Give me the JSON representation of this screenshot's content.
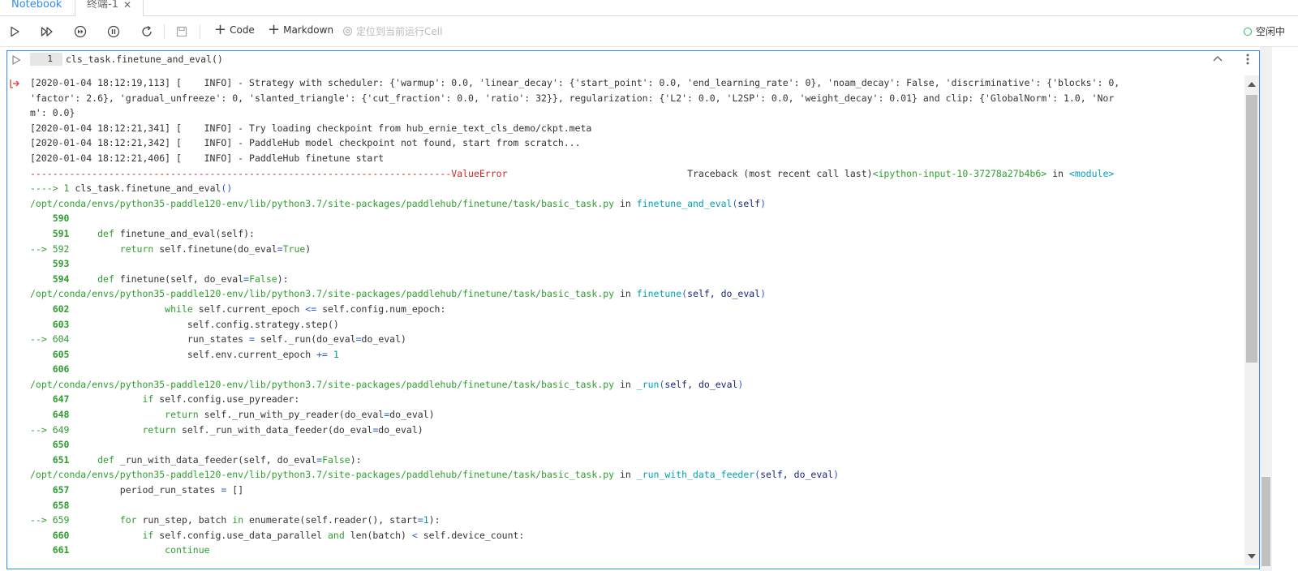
{
  "tabs": [
    {
      "label": "Notebook"
    },
    {
      "label": "终端-1"
    }
  ],
  "toolbar": {
    "code_label": "Code",
    "markdown_label": "Markdown",
    "locate_label": "定位到当前运行Cell",
    "status_label": "空闲中",
    "status_color": "#19be6b"
  },
  "cell": {
    "line_number": "1",
    "code": "cls_task.finetune_and_eval()"
  },
  "output": {
    "lines": [
      [
        {
          "t": "[2020-01-04 18:12:19,113] [    INFO] - Strategy with scheduler: {'warmup': 0.0, 'linear_decay': {'start_point': 0.0, 'end_learning_rate': 0}, 'noam_decay': False, 'discriminative': {'blocks': 0,",
          "c": ""
        }
      ],
      [
        {
          "t": "'factor': 2.6}, 'gradual_unfreeze': 0, 'slanted_triangle': {'cut_fraction': 0.0, 'ratio': 32}}, regularization: {'L2': 0.0, 'L2SP': 0.0, 'weight_decay': 0.01} and clip: {'GlobalNorm': 1.0, 'Nor",
          "c": ""
        }
      ],
      [
        {
          "t": "m': 0.0}",
          "c": ""
        }
      ],
      [
        {
          "t": "[2020-01-04 18:12:21,341] [    INFO] - Try loading checkpoint from hub_ernie_text_cls_demo/ckpt.meta",
          "c": ""
        }
      ],
      [
        {
          "t": "[2020-01-04 18:12:21,342] [    INFO] - PaddleHub model checkpoint not found, start from scratch...",
          "c": ""
        }
      ],
      [
        {
          "t": "[2020-01-04 18:12:21,406] [    INFO] - PaddleHub finetune start",
          "c": ""
        }
      ],
      [
        {
          "t": "---------------------------------------------------------------------------ValueError",
          "c": "red"
        },
        {
          "t": "                                Traceback (most recent call last)",
          "c": ""
        },
        {
          "t": "<ipython-input-10-37278a27b4b6>",
          "c": "green"
        },
        {
          "t": " in ",
          "c": ""
        },
        {
          "t": "<module>",
          "c": "teal"
        }
      ],
      [
        {
          "t": "----> 1 ",
          "c": "green"
        },
        {
          "t": "cls_task",
          "c": ""
        },
        {
          "t": ".",
          "c": ""
        },
        {
          "t": "finetune_and_eval",
          "c": ""
        },
        {
          "t": "()",
          "c": "blue"
        }
      ],
      [
        {
          "t": "/opt/conda/envs/python35-paddle120-env/lib/python3.7/site-packages/paddlehub/finetune/task/basic_task.py",
          "c": "green"
        },
        {
          "t": " in ",
          "c": ""
        },
        {
          "t": "finetune_and_eval",
          "c": "teal"
        },
        {
          "t": "(",
          "c": "blue"
        },
        {
          "t": "self",
          "c": "navy"
        },
        {
          "t": ")",
          "c": "blue"
        }
      ],
      [
        {
          "t": "    590",
          "c": "lno"
        }
      ],
      [
        {
          "t": "    591     ",
          "c": "lno"
        },
        {
          "t": "def",
          "c": "kw"
        },
        {
          "t": " finetune_and_eval(self):",
          "c": ""
        }
      ],
      [
        {
          "t": "--> 592         ",
          "c": "green"
        },
        {
          "t": "return",
          "c": "kw"
        },
        {
          "t": " self.finetune(do_eval",
          "c": ""
        },
        {
          "t": "=",
          "c": "blue"
        },
        {
          "t": "True",
          "c": "kw"
        },
        {
          "t": ")",
          "c": ""
        }
      ],
      [
        {
          "t": "    593",
          "c": "lno"
        }
      ],
      [
        {
          "t": "    594     ",
          "c": "lno"
        },
        {
          "t": "def",
          "c": "kw"
        },
        {
          "t": " finetune(self, do_eval",
          "c": ""
        },
        {
          "t": "=",
          "c": "blue"
        },
        {
          "t": "False",
          "c": "kw"
        },
        {
          "t": "):",
          "c": ""
        }
      ],
      [
        {
          "t": "/opt/conda/envs/python35-paddle120-env/lib/python3.7/site-packages/paddlehub/finetune/task/basic_task.py",
          "c": "green"
        },
        {
          "t": " in ",
          "c": ""
        },
        {
          "t": "finetune",
          "c": "teal"
        },
        {
          "t": "(",
          "c": "blue"
        },
        {
          "t": "self, do_eval",
          "c": "navy"
        },
        {
          "t": ")",
          "c": "blue"
        }
      ],
      [
        {
          "t": "    602                 ",
          "c": "lno"
        },
        {
          "t": "while",
          "c": "kw"
        },
        {
          "t": " self.current_epoch ",
          "c": ""
        },
        {
          "t": "<=",
          "c": "blue"
        },
        {
          "t": " self.config.num_epoch:",
          "c": ""
        }
      ],
      [
        {
          "t": "    603                     ",
          "c": "lno"
        },
        {
          "t": "self.config.strategy.step()",
          "c": ""
        }
      ],
      [
        {
          "t": "--> 604                     ",
          "c": "green"
        },
        {
          "t": "run_states ",
          "c": ""
        },
        {
          "t": "=",
          "c": "blue"
        },
        {
          "t": " self._run(do_eval",
          "c": ""
        },
        {
          "t": "=",
          "c": "blue"
        },
        {
          "t": "do_eval)",
          "c": ""
        }
      ],
      [
        {
          "t": "    605                     ",
          "c": "lno"
        },
        {
          "t": "self.env.current_epoch ",
          "c": ""
        },
        {
          "t": "+=",
          "c": "blue"
        },
        {
          "t": " ",
          "c": ""
        },
        {
          "t": "1",
          "c": "num"
        }
      ],
      [
        {
          "t": "    606",
          "c": "lno"
        }
      ],
      [
        {
          "t": "/opt/conda/envs/python35-paddle120-env/lib/python3.7/site-packages/paddlehub/finetune/task/basic_task.py",
          "c": "green"
        },
        {
          "t": " in ",
          "c": ""
        },
        {
          "t": "_run",
          "c": "teal"
        },
        {
          "t": "(",
          "c": "blue"
        },
        {
          "t": "self, do_eval",
          "c": "navy"
        },
        {
          "t": ")",
          "c": "blue"
        }
      ],
      [
        {
          "t": "    647             ",
          "c": "lno"
        },
        {
          "t": "if",
          "c": "kw"
        },
        {
          "t": " self.config.use_pyreader:",
          "c": ""
        }
      ],
      [
        {
          "t": "    648                 ",
          "c": "lno"
        },
        {
          "t": "return",
          "c": "kw"
        },
        {
          "t": " self._run_with_py_reader(do_eval",
          "c": ""
        },
        {
          "t": "=",
          "c": "blue"
        },
        {
          "t": "do_eval)",
          "c": ""
        }
      ],
      [
        {
          "t": "--> 649             ",
          "c": "green"
        },
        {
          "t": "return",
          "c": "kw"
        },
        {
          "t": " self._run_with_data_feeder(do_eval",
          "c": ""
        },
        {
          "t": "=",
          "c": "blue"
        },
        {
          "t": "do_eval)",
          "c": ""
        }
      ],
      [
        {
          "t": "    650",
          "c": "lno"
        }
      ],
      [
        {
          "t": "    651     ",
          "c": "lno"
        },
        {
          "t": "def",
          "c": "kw"
        },
        {
          "t": " _run_with_data_feeder(self, do_eval",
          "c": ""
        },
        {
          "t": "=",
          "c": "blue"
        },
        {
          "t": "False",
          "c": "kw"
        },
        {
          "t": "):",
          "c": ""
        }
      ],
      [
        {
          "t": "/opt/conda/envs/python35-paddle120-env/lib/python3.7/site-packages/paddlehub/finetune/task/basic_task.py",
          "c": "green"
        },
        {
          "t": " in ",
          "c": ""
        },
        {
          "t": "_run_with_data_feeder",
          "c": "teal"
        },
        {
          "t": "(",
          "c": "blue"
        },
        {
          "t": "self, do_eval",
          "c": "navy"
        },
        {
          "t": ")",
          "c": "blue"
        }
      ],
      [
        {
          "t": "    657         ",
          "c": "lno"
        },
        {
          "t": "period_run_states ",
          "c": ""
        },
        {
          "t": "=",
          "c": "blue"
        },
        {
          "t": " []",
          "c": ""
        }
      ],
      [
        {
          "t": "    658",
          "c": "lno"
        }
      ],
      [
        {
          "t": "--> 659         ",
          "c": "green"
        },
        {
          "t": "for",
          "c": "kw"
        },
        {
          "t": " run_step, batch ",
          "c": ""
        },
        {
          "t": "in",
          "c": "kw"
        },
        {
          "t": " enumerate(self.reader(), start",
          "c": ""
        },
        {
          "t": "=",
          "c": "blue"
        },
        {
          "t": "1",
          "c": "num"
        },
        {
          "t": "):",
          "c": ""
        }
      ],
      [
        {
          "t": "    660             ",
          "c": "lno"
        },
        {
          "t": "if",
          "c": "kw"
        },
        {
          "t": " self.config.use_data_parallel ",
          "c": ""
        },
        {
          "t": "and",
          "c": "kw"
        },
        {
          "t": " len(batch) ",
          "c": ""
        },
        {
          "t": "<",
          "c": "blue"
        },
        {
          "t": " self.device_count:",
          "c": ""
        }
      ],
      [
        {
          "t": "    661                 ",
          "c": "lno"
        },
        {
          "t": "continue",
          "c": "kw"
        }
      ]
    ]
  }
}
